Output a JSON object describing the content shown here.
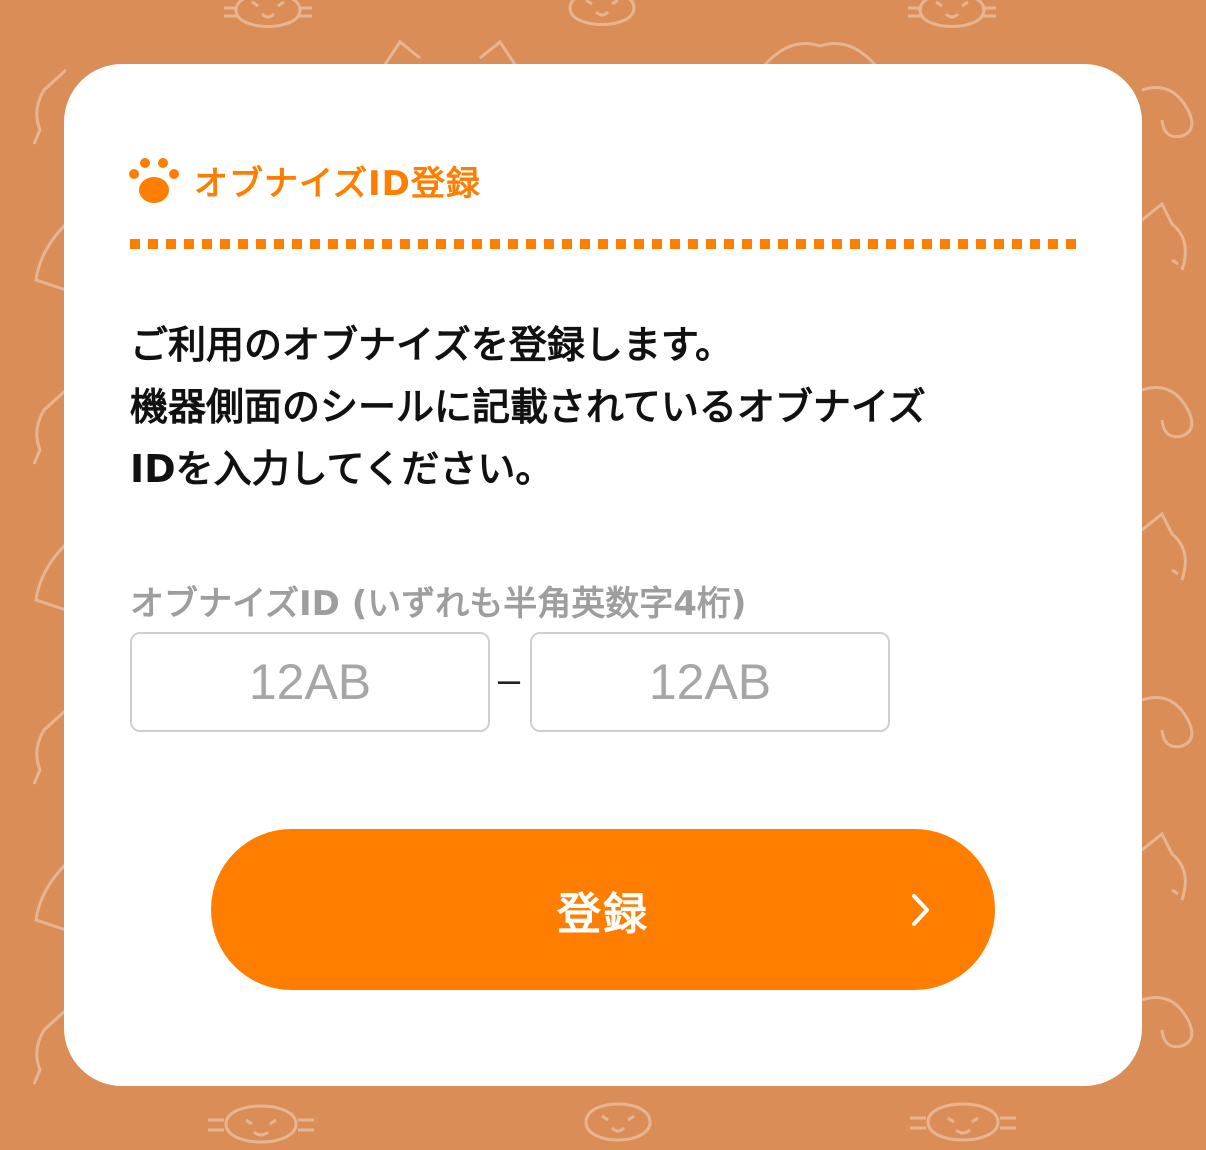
{
  "colors": {
    "background": "#DB8D57",
    "accent": "#FF7E00",
    "card": "#FFFFFF",
    "text": "#111111",
    "muted": "#9E9E9E"
  },
  "header": {
    "icon": "paw-icon",
    "title": "オブナイズID登録"
  },
  "description": {
    "line1": "ご利用のオブナイズを登録します。",
    "line2": "機器側面のシールに記載されているオブナイズ",
    "line3": "IDを入力してください。"
  },
  "form": {
    "label": "オブナイズID (いずれも半角英数字4桁)",
    "input1": {
      "value": "",
      "placeholder": "12AB"
    },
    "separator": "–",
    "input2": {
      "value": "",
      "placeholder": "12AB"
    }
  },
  "submit": {
    "label": "登録",
    "icon": "chevron-right-icon"
  },
  "background_pattern": {
    "icons": [
      "cat-face-icon",
      "dog-face-icon"
    ]
  }
}
